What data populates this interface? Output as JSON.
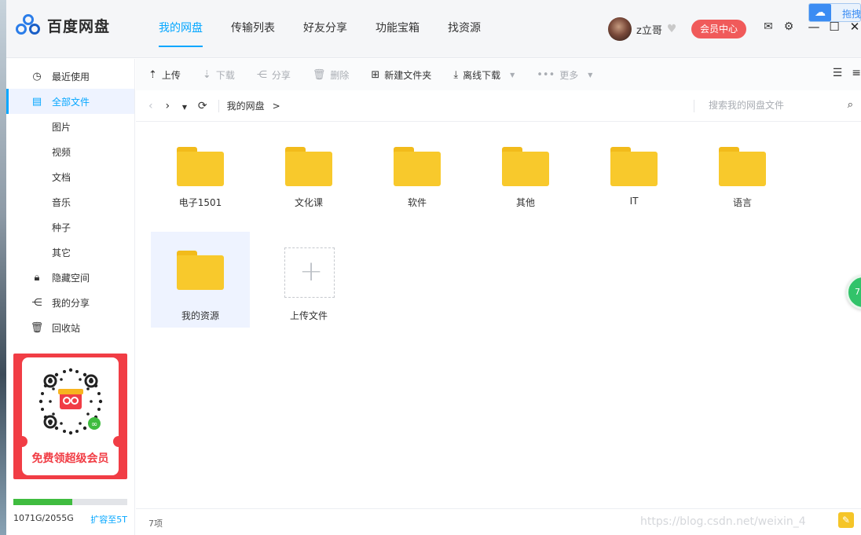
{
  "app": {
    "name": "百度网盘"
  },
  "nav": {
    "items": [
      {
        "label": "我的网盘",
        "active": true
      },
      {
        "label": "传输列表",
        "active": false
      },
      {
        "label": "好友分享",
        "active": false
      },
      {
        "label": "功能宝箱",
        "active": false
      },
      {
        "label": "找资源",
        "active": false
      }
    ]
  },
  "user": {
    "name": "z立哥",
    "member_button": "会员中心"
  },
  "float_badge": {
    "label": "拖拽"
  },
  "sidebar": {
    "items": [
      {
        "label": "最近使用",
        "icon": "clock-icon"
      },
      {
        "label": "全部文件",
        "icon": "file-icon",
        "active": true
      },
      {
        "label": "图片"
      },
      {
        "label": "视频"
      },
      {
        "label": "文档"
      },
      {
        "label": "音乐"
      },
      {
        "label": "种子"
      },
      {
        "label": "其它"
      },
      {
        "label": "隐藏空间",
        "icon": "lock-icon"
      },
      {
        "label": "我的分享",
        "icon": "share-icon"
      },
      {
        "label": "回收站",
        "icon": "trash-icon"
      }
    ],
    "promo": {
      "caption": "免费领超级会员"
    },
    "storage": {
      "used": "1071G/2055G",
      "used_fraction": 0.52,
      "expand_label": "扩容至5T"
    }
  },
  "toolbar": {
    "upload": "上传",
    "download": "下载",
    "share": "分享",
    "delete": "删除",
    "new_folder": "新建文件夹",
    "offline_download": "离线下载",
    "more": "更多"
  },
  "pathbar": {
    "crumb": "我的网盘",
    "crumb_arrow": ">",
    "search_placeholder": "搜索我的网盘文件"
  },
  "files": [
    {
      "name": "电子1501",
      "type": "folder"
    },
    {
      "name": "文化课",
      "type": "folder"
    },
    {
      "name": "软件",
      "type": "folder"
    },
    {
      "name": "其他",
      "type": "folder"
    },
    {
      "name": "IT",
      "type": "folder"
    },
    {
      "name": "语言",
      "type": "folder"
    },
    {
      "name": "我的资源",
      "type": "folder",
      "selected": true
    }
  ],
  "upload_tile": {
    "label": "上传文件"
  },
  "status": {
    "item_count": "7项",
    "watermark": "https://blog.csdn.net/weixin_4"
  },
  "colors": {
    "accent": "#06a7ff",
    "member_button": "#f05a5a",
    "folder": "#f8c92c",
    "storage_fill": "#3fbc3f",
    "promo_red": "#f13d45"
  }
}
